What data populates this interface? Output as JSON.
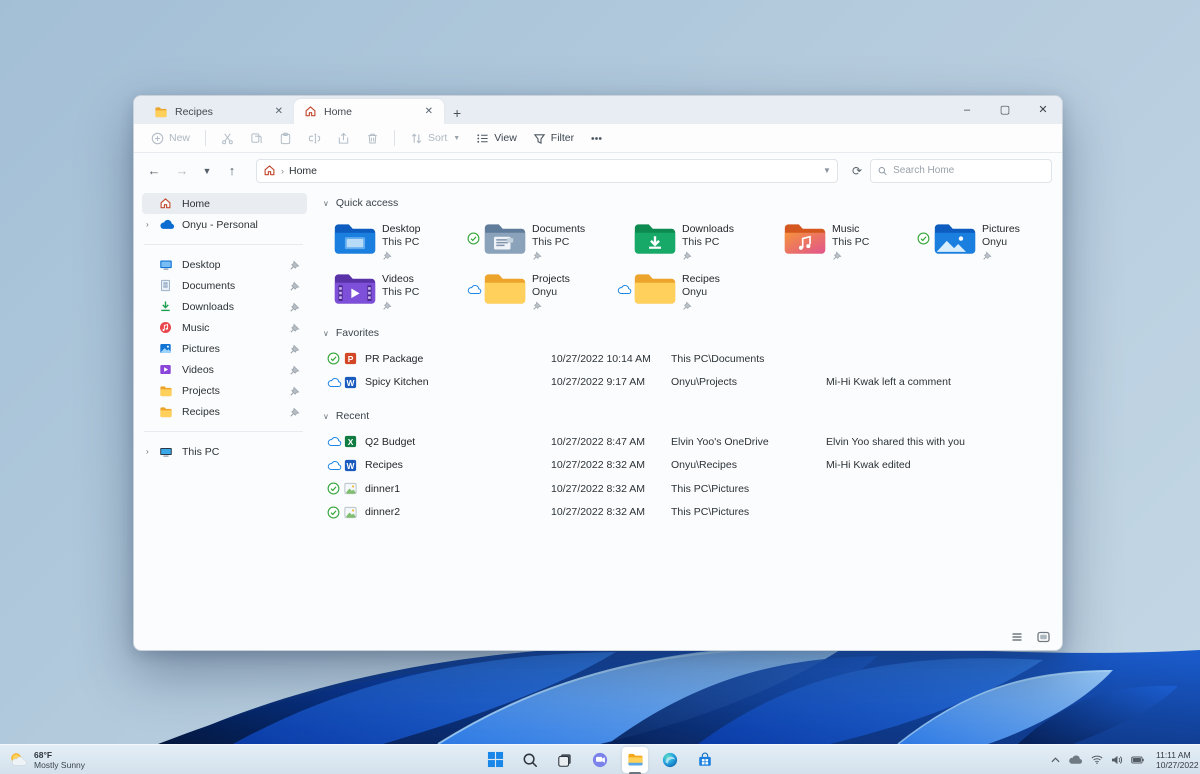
{
  "window": {
    "tabs": [
      {
        "label": "Recipes",
        "icon": "folder",
        "active": false
      },
      {
        "label": "Home",
        "icon": "home",
        "active": true
      }
    ],
    "new_tab_label": "+",
    "controls": {
      "minimize": "–",
      "maximize": "▢",
      "close": "✕"
    },
    "toolbar": {
      "items": [
        {
          "name": "new-button",
          "icon": "new",
          "label": "New",
          "disabled": true,
          "chevron": false
        },
        {
          "divider": true
        },
        {
          "name": "cut-button",
          "icon": "cut",
          "disabled": true
        },
        {
          "name": "copy-button",
          "icon": "copy",
          "disabled": true
        },
        {
          "name": "paste-button",
          "icon": "paste",
          "disabled": true
        },
        {
          "name": "rename-button",
          "icon": "rename",
          "disabled": true
        },
        {
          "name": "share-button",
          "icon": "share",
          "disabled": true
        },
        {
          "name": "delete-button",
          "icon": "trash",
          "disabled": true
        },
        {
          "divider": true
        },
        {
          "name": "sort-button",
          "icon": "sort",
          "label": "Sort",
          "disabled": true,
          "chevron": true
        },
        {
          "name": "view-button",
          "icon": "view",
          "label": "View",
          "disabled": false
        },
        {
          "name": "filter-button",
          "icon": "filter",
          "label": "Filter",
          "disabled": false
        },
        {
          "name": "more-button",
          "icon": "more",
          "disabled": false
        }
      ]
    },
    "navigation": {
      "breadcrumb_root_icon": "home",
      "breadcrumb": "Home",
      "search_placeholder": "Search Home"
    }
  },
  "sidebar": {
    "groups": [
      [
        {
          "label": "Home",
          "icon": "home",
          "selected": true
        },
        {
          "label": "Onyu - Personal",
          "icon": "onedrive",
          "expander": true
        }
      ],
      [
        {
          "label": "Desktop",
          "icon": "desktop",
          "pinned": true
        },
        {
          "label": "Documents",
          "icon": "document",
          "pinned": true
        },
        {
          "label": "Downloads",
          "icon": "download",
          "pinned": true
        },
        {
          "label": "Music",
          "icon": "music",
          "pinned": true
        },
        {
          "label": "Pictures",
          "icon": "pictures",
          "pinned": true
        },
        {
          "label": "Videos",
          "icon": "videos",
          "pinned": true
        },
        {
          "label": "Projects",
          "icon": "folder",
          "pinned": true
        },
        {
          "label": "Recipes",
          "icon": "folder",
          "pinned": true
        }
      ],
      [
        {
          "label": "This PC",
          "icon": "pc",
          "expander": true
        }
      ]
    ]
  },
  "content": {
    "quick_access": {
      "title": "Quick access",
      "items": [
        {
          "name": "Desktop",
          "location": "This PC",
          "icon": "folder-desktop",
          "badge": "",
          "pinned": true
        },
        {
          "name": "Documents",
          "location": "This PC",
          "icon": "folder-documents",
          "badge": "synced",
          "pinned": true
        },
        {
          "name": "Downloads",
          "location": "This PC",
          "icon": "folder-downloads",
          "badge": "",
          "pinned": true
        },
        {
          "name": "Music",
          "location": "This PC",
          "icon": "folder-music",
          "badge": "",
          "pinned": true
        },
        {
          "name": "Pictures",
          "location": "Onyu",
          "icon": "folder-pictures",
          "badge": "synced",
          "pinned": true
        },
        {
          "name": "Videos",
          "location": "This PC",
          "icon": "folder-videos",
          "badge": "",
          "pinned": true
        },
        {
          "name": "Projects",
          "location": "Onyu",
          "icon": "folder-big",
          "badge": "cloud",
          "pinned": true
        },
        {
          "name": "Recipes",
          "location": "Onyu",
          "icon": "folder-big",
          "badge": "cloud",
          "pinned": true
        }
      ]
    },
    "favorites": {
      "title": "Favorites",
      "rows": [
        {
          "name": "PR Package",
          "badge": "synced",
          "icon": "file-powerpoint",
          "date": "10/27/2022 10:14 AM",
          "location": "This PC\\Documents",
          "activity": ""
        },
        {
          "name": "Spicy Kitchen",
          "badge": "cloud",
          "icon": "file-word",
          "date": "10/27/2022 9:17 AM",
          "location": "Onyu\\Projects",
          "activity": "Mi-Hi Kwak left a comment"
        }
      ]
    },
    "recent": {
      "title": "Recent",
      "rows": [
        {
          "name": "Q2 Budget",
          "badge": "cloud",
          "icon": "file-excel",
          "date": "10/27/2022 8:47 AM",
          "location": "Elvin Yoo's OneDrive",
          "activity": "Elvin Yoo shared this with you"
        },
        {
          "name": "Recipes",
          "badge": "cloud",
          "icon": "file-word",
          "date": "10/27/2022 8:32 AM",
          "location": "Onyu\\Recipes",
          "activity": "Mi-Hi Kwak edited"
        },
        {
          "name": "dinner1",
          "badge": "synced",
          "icon": "file-image",
          "date": "10/27/2022 8:32 AM",
          "location": "This PC\\Pictures",
          "activity": ""
        },
        {
          "name": "dinner2",
          "badge": "synced",
          "icon": "file-image",
          "date": "10/27/2022 8:32 AM",
          "location": "This PC\\Pictures",
          "activity": ""
        }
      ]
    }
  },
  "taskbar": {
    "weather": {
      "temperature": "68°F",
      "condition": "Mostly Sunny"
    },
    "apps": [
      {
        "name": "start",
        "icon": "windows",
        "active": false
      },
      {
        "name": "search",
        "icon": "tb-search",
        "active": false
      },
      {
        "name": "task-view",
        "icon": "taskview",
        "active": false
      },
      {
        "name": "teams-chat",
        "icon": "teams",
        "active": false
      },
      {
        "name": "file-explorer",
        "icon": "explorer",
        "active": true
      },
      {
        "name": "edge",
        "icon": "edge",
        "active": false
      },
      {
        "name": "store",
        "icon": "store",
        "active": false
      }
    ],
    "tray": {
      "icons": [
        "chevron-up",
        "cloud-tray",
        "wifi",
        "volume",
        "battery"
      ],
      "time": "11:11 AM",
      "date": "10/27/2022"
    }
  },
  "colors": {
    "accent": "#1173d4",
    "synced_badge": "#37a73c",
    "cloud_badge": "#1b84e8",
    "folder_yellow": "#ffcd4e"
  }
}
